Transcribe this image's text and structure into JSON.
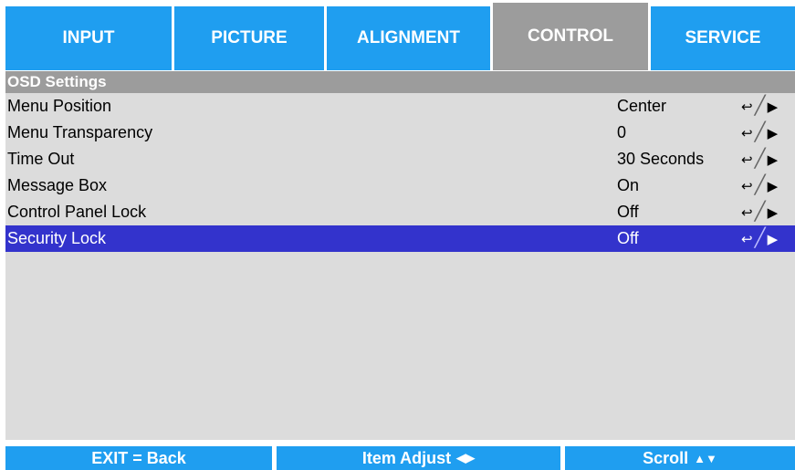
{
  "tabs": [
    {
      "label": "INPUT"
    },
    {
      "label": "PICTURE"
    },
    {
      "label": "ALIGNMENT"
    },
    {
      "label": "CONTROL"
    },
    {
      "label": "SERVICE"
    }
  ],
  "section": {
    "title": "OSD Settings"
  },
  "rows": [
    {
      "label": "Menu Position",
      "value": "Center"
    },
    {
      "label": "Menu Transparency",
      "value": "0"
    },
    {
      "label": "Time Out",
      "value": "30 Seconds"
    },
    {
      "label": "Message Box",
      "value": "On"
    },
    {
      "label": "Control Panel Lock",
      "value": "Off"
    },
    {
      "label": "Security Lock",
      "value": "Off"
    }
  ],
  "glyphs": {
    "enter": "↩",
    "slash": "╱",
    "right": "▶"
  },
  "footer": {
    "exit": "EXIT = Back",
    "adjust": "Item Adjust",
    "adjust_sym": "◀▶",
    "scroll": "Scroll",
    "scroll_sym": "▲▼"
  },
  "colors": {
    "tab": "#1f9ef0",
    "active_tab": "#9c9c9c",
    "panel": "#dcdcdc",
    "selected": "#3333cc"
  }
}
